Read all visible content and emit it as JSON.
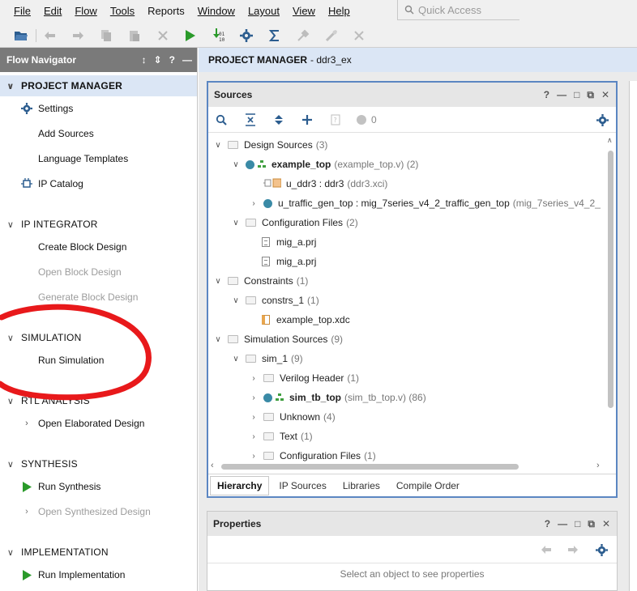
{
  "menu": [
    "File",
    "Edit",
    "Flow",
    "Tools",
    "Reports",
    "Window",
    "Layout",
    "View",
    "Help"
  ],
  "quick_access": {
    "placeholder": "Quick Access"
  },
  "toolbar": {
    "icons": [
      "open-project-icon",
      "undo-icon",
      "redo-icon",
      "copy-icon",
      "paste-icon",
      "delete-icon",
      "run-icon",
      "generate-bitstream-icon",
      "settings-icon",
      "sigma-report-icon",
      "disabled-wrench-icon",
      "disabled-tool-icon",
      "disabled-close-icon"
    ],
    "accent": "#2a9a2a"
  },
  "flow_navigator": {
    "title": "Flow Navigator",
    "sections": [
      {
        "label": "PROJECT MANAGER",
        "active": true,
        "items": [
          {
            "label": "Settings",
            "icon": "gear-icon",
            "enabled": true
          },
          {
            "label": "Add Sources",
            "enabled": true
          },
          {
            "label": "Language Templates",
            "enabled": true
          },
          {
            "label": "IP Catalog",
            "icon": "ip-catalog-icon",
            "enabled": true
          }
        ]
      },
      {
        "label": "IP INTEGRATOR",
        "items": [
          {
            "label": "Create Block Design",
            "enabled": true
          },
          {
            "label": "Open Block Design",
            "enabled": false
          },
          {
            "label": "Generate Block Design",
            "enabled": false
          }
        ]
      },
      {
        "label": "SIMULATION",
        "items": [
          {
            "label": "Run Simulation",
            "enabled": true
          }
        ]
      },
      {
        "label": "RTL ANALYSIS",
        "items": [
          {
            "label": "Open Elaborated Design",
            "enabled": true,
            "expandable": true
          }
        ]
      },
      {
        "label": "SYNTHESIS",
        "items": [
          {
            "label": "Run Synthesis",
            "icon": "play-icon",
            "enabled": true
          },
          {
            "label": "Open Synthesized Design",
            "enabled": false,
            "expandable": true
          }
        ]
      },
      {
        "label": "IMPLEMENTATION",
        "items": [
          {
            "label": "Run Implementation",
            "icon": "play-icon",
            "enabled": true
          }
        ]
      }
    ]
  },
  "project_manager": {
    "title": "PROJECT MANAGER",
    "project": "- ddr3_ex"
  },
  "sources": {
    "title": "Sources",
    "badge_count": "0",
    "tree": [
      {
        "label": "Design Sources",
        "count": "(3)"
      },
      {
        "label": "example_top",
        "detail": "(example_top.v) (2)"
      },
      {
        "label": "u_ddr3 : ddr3",
        "detail": "(ddr3.xci)"
      },
      {
        "label": "u_traffic_gen_top : mig_7series_v4_2_traffic_gen_top",
        "detail": "(mig_7series_v4_2_"
      },
      {
        "label": "Configuration Files",
        "count": "(2)"
      },
      {
        "label": "mig_a.prj"
      },
      {
        "label": "mig_a.prj"
      },
      {
        "label": "Constraints",
        "count": "(1)"
      },
      {
        "label": "constrs_1",
        "count": "(1)"
      },
      {
        "label": "example_top.xdc"
      },
      {
        "label": "Simulation Sources",
        "count": "(9)"
      },
      {
        "label": "sim_1",
        "count": "(9)"
      },
      {
        "label": "Verilog Header",
        "count": "(1)"
      },
      {
        "label": "sim_tb_top",
        "detail": "(sim_tb_top.v) (86)"
      },
      {
        "label": "Unknown",
        "count": "(4)"
      },
      {
        "label": "Text",
        "count": "(1)"
      },
      {
        "label": "Configuration Files",
        "count": "(1)"
      }
    ],
    "tabs": [
      "Hierarchy",
      "IP Sources",
      "Libraries",
      "Compile Order"
    ],
    "active_tab": "Hierarchy"
  },
  "properties": {
    "title": "Properties",
    "empty_text": "Select an object to see properties"
  },
  "annotation": {
    "color": "#e8191b"
  }
}
